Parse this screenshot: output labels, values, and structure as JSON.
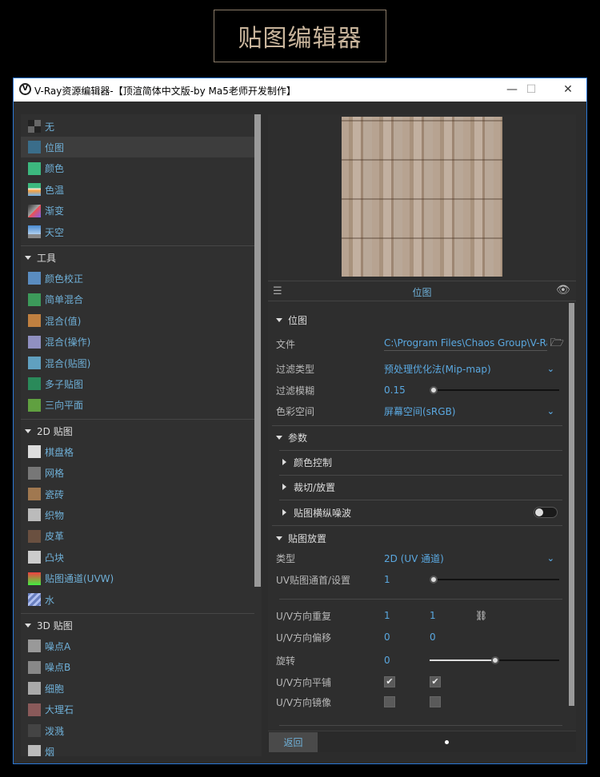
{
  "banner": {
    "title": "贴图编辑器"
  },
  "window": {
    "title": "V-Ray资源编辑器-【顶渲简体中文版-by Ma5老师开发制作】",
    "minimize": "—",
    "maximize": "☐",
    "close": "✕"
  },
  "left": {
    "top_items": [
      {
        "label": "无",
        "icon": "none-icon"
      },
      {
        "label": "位图",
        "icon": "bitmap-icon"
      },
      {
        "label": "颜色",
        "icon": "color-icon"
      },
      {
        "label": "色温",
        "icon": "color-temperature-icon"
      },
      {
        "label": "渐变",
        "icon": "gradient-icon"
      },
      {
        "label": "天空",
        "icon": "sky-icon"
      }
    ],
    "groups": [
      {
        "title": "工具",
        "items": [
          "颜色校正",
          "简单混合",
          "混合(值)",
          "混合(操作)",
          "混合(贴图)",
          "多子贴图",
          "三向平面"
        ]
      },
      {
        "title": "2D 贴图",
        "items": [
          "棋盘格",
          "网格",
          "瓷砖",
          "织物",
          "皮革",
          "凸块",
          "贴图通道(UVW)",
          "水"
        ]
      },
      {
        "title": "3D 贴图",
        "items": [
          "噪点A",
          "噪点B",
          "细胞",
          "大理石",
          "泼溅",
          "烟"
        ]
      }
    ],
    "selected": "位图"
  },
  "right": {
    "header_title": "位图",
    "sections": {
      "bitmap": "位图",
      "params": "参数",
      "color_control": "颜色控制",
      "crop": "裁切/放置",
      "noise": "贴图横纵噪波",
      "placement": "贴图放置"
    },
    "fields": {
      "file_label": "文件",
      "file_value": "C:\\Program Files\\Chaos Group\\V-Ra...",
      "filter_type_label": "过滤类型",
      "filter_type_value": "预处理优化法(Mip-map)",
      "filter_blur_label": "过滤模糊",
      "filter_blur_value": "0.15",
      "color_space_label": "色彩空间",
      "color_space_value": "屏幕空间(sRGB)",
      "type_label": "类型",
      "type_value": "2D (UV 通道)",
      "uv_channel_label": "UV贴图通首/设置",
      "uv_channel_value": "1",
      "repeat_label": "U/V方向重复",
      "repeat_u": "1",
      "repeat_v": "1",
      "offset_label": "U/V方向偏移",
      "offset_u": "0",
      "offset_v": "0",
      "rotate_label": "旋转",
      "rotate_value": "0",
      "tile_label": "U/V方向平铺",
      "mirror_label": "U/V方向镜像"
    },
    "noise_enabled": false,
    "tile_u": true,
    "tile_v": true,
    "mirror_u": false,
    "mirror_v": false,
    "back_label": "返回"
  },
  "colors": {
    "accent": "#5aa8e0",
    "window_border": "#2a78d8"
  }
}
